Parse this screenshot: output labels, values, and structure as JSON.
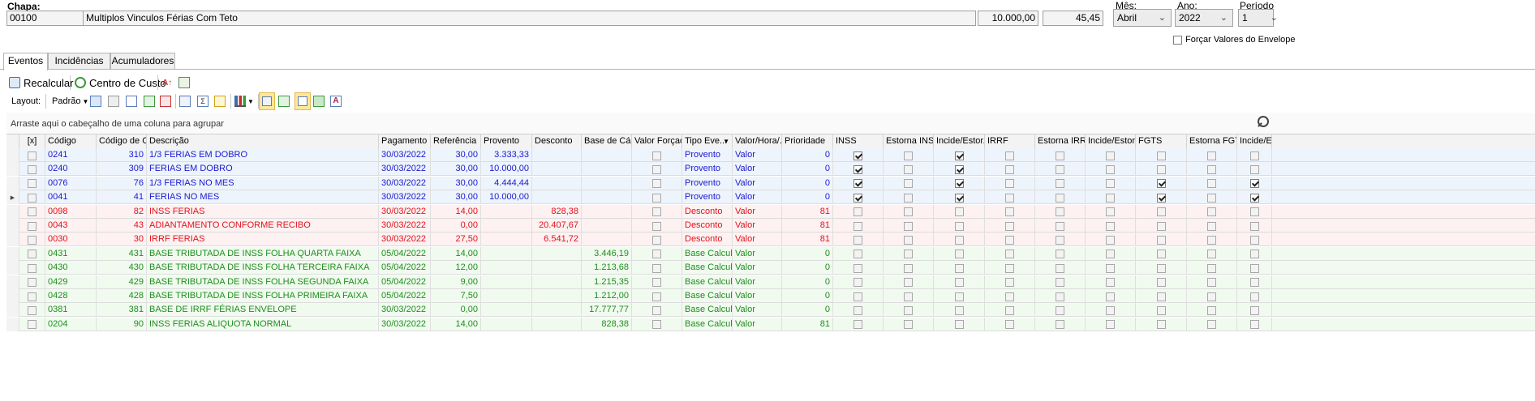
{
  "header": {
    "chapa_label": "Chapa:",
    "chapa_code": "00100",
    "chapa_desc": "Multiplos Vinculos Férias Com Teto",
    "value1": "10.000,00",
    "value2": "45,45",
    "mes_label": "Mês:",
    "mes_value": "Abril",
    "ano_label": "Ano:",
    "ano_value": "2022",
    "periodo_label": "Período",
    "periodo_value": "1",
    "forcar_label": "Forçar Valores do Envelope"
  },
  "tabs": [
    {
      "label": "Eventos",
      "active": true
    },
    {
      "label": "Incidências",
      "active": false
    },
    {
      "label": "Acumuladores",
      "active": false
    }
  ],
  "toolbar": {
    "recalcular": "Recalcular",
    "centro_custo": "Centro de Custo",
    "layout_label": "Layout:",
    "layout_value": "Padrão"
  },
  "group_hint": "Arraste aqui o cabeçalho de uma coluna para agrupar",
  "columns": [
    "[x]",
    "Código",
    "Código de C...",
    "Descrição",
    "Pagamento",
    "Referência",
    "Provento",
    "Desconto",
    "Base de Cál...",
    "Valor Forçado",
    "Tipo Eve...",
    "Valor/Hora/...",
    "Prioridade",
    "INSS",
    "Estorna INSS",
    "Incide/Estor...",
    "IRRF",
    "Estorna IRRF",
    "Incide/Estor...",
    "FGTS",
    "Estorna FGTS",
    "Incide/Est"
  ],
  "colors": {
    "blue": "#1a1ad0",
    "red": "#e0141e",
    "green": "#1e8f1e",
    "blue_bg": "#eef4fc",
    "red_bg": "#fdf1f1",
    "green_bg": "#f1faef"
  },
  "rows": [
    {
      "type": "blue",
      "codigo": "0241",
      "cod_c": "310",
      "descricao": "1/3 FERIAS EM DOBRO",
      "pagamento": "30/03/2022",
      "referencia": "30,00",
      "provento": "3.333,33",
      "desconto": "",
      "base": "",
      "tipo": "Provento",
      "valor_hora": "Valor",
      "prioridade": "0",
      "inss": true,
      "incide1": true,
      "fgts": false,
      "incide3": false,
      "current": false
    },
    {
      "type": "blue",
      "codigo": "0240",
      "cod_c": "309",
      "descricao": "FERIAS EM DOBRO",
      "pagamento": "30/03/2022",
      "referencia": "30,00",
      "provento": "10.000,00",
      "desconto": "",
      "base": "",
      "tipo": "Provento",
      "valor_hora": "Valor",
      "prioridade": "0",
      "inss": true,
      "incide1": true,
      "fgts": false,
      "incide3": false,
      "current": false
    },
    {
      "type": "blue",
      "codigo": "0076",
      "cod_c": "76",
      "descricao": "1/3 FERIAS NO MES",
      "pagamento": "30/03/2022",
      "referencia": "30,00",
      "provento": "4.444,44",
      "desconto": "",
      "base": "",
      "tipo": "Provento",
      "valor_hora": "Valor",
      "prioridade": "0",
      "inss": true,
      "incide1": true,
      "fgts": true,
      "incide3": true,
      "current": false
    },
    {
      "type": "blue",
      "codigo": "0041",
      "cod_c": "41",
      "descricao": "FERIAS NO MES",
      "pagamento": "30/03/2022",
      "referencia": "30,00",
      "provento": "10.000,00",
      "desconto": "",
      "base": "",
      "tipo": "Provento",
      "valor_hora": "Valor",
      "prioridade": "0",
      "inss": true,
      "incide1": true,
      "fgts": true,
      "incide3": true,
      "current": true
    },
    {
      "type": "red",
      "codigo": "0098",
      "cod_c": "82",
      "descricao": "INSS FERIAS",
      "pagamento": "30/03/2022",
      "referencia": "14,00",
      "provento": "",
      "desconto": "828,38",
      "base": "",
      "tipo": "Desconto",
      "valor_hora": "Valor",
      "prioridade": "81",
      "inss": false,
      "incide1": false,
      "fgts": false,
      "incide3": false,
      "current": false
    },
    {
      "type": "red",
      "codigo": "0043",
      "cod_c": "43",
      "descricao": "ADIANTAMENTO CONFORME RECIBO",
      "pagamento": "30/03/2022",
      "referencia": "0,00",
      "provento": "",
      "desconto": "20.407,67",
      "base": "",
      "tipo": "Desconto",
      "valor_hora": "Valor",
      "prioridade": "81",
      "inss": false,
      "incide1": false,
      "fgts": false,
      "incide3": false,
      "current": false
    },
    {
      "type": "red",
      "codigo": "0030",
      "cod_c": "30",
      "descricao": "IRRF FERIAS",
      "pagamento": "30/03/2022",
      "referencia": "27,50",
      "provento": "",
      "desconto": "6.541,72",
      "base": "",
      "tipo": "Desconto",
      "valor_hora": "Valor",
      "prioridade": "81",
      "inss": false,
      "incide1": false,
      "fgts": false,
      "incide3": false,
      "current": false
    },
    {
      "type": "green",
      "codigo": "0431",
      "cod_c": "431",
      "descricao": "BASE TRIBUTADA DE INSS FOLHA QUARTA FAIXA",
      "pagamento": "05/04/2022",
      "referencia": "14,00",
      "provento": "",
      "desconto": "",
      "base": "3.446,19",
      "tipo": "Base Calculo",
      "valor_hora": "Valor",
      "prioridade": "0",
      "inss": false,
      "incide1": false,
      "fgts": false,
      "incide3": false,
      "current": false
    },
    {
      "type": "green",
      "codigo": "0430",
      "cod_c": "430",
      "descricao": "BASE TRIBUTADA DE INSS FOLHA TERCEIRA FAIXA",
      "pagamento": "05/04/2022",
      "referencia": "12,00",
      "provento": "",
      "desconto": "",
      "base": "1.213,68",
      "tipo": "Base Calculo",
      "valor_hora": "Valor",
      "prioridade": "0",
      "inss": false,
      "incide1": false,
      "fgts": false,
      "incide3": false,
      "current": false
    },
    {
      "type": "green",
      "codigo": "0429",
      "cod_c": "429",
      "descricao": "BASE TRIBUTADA DE INSS FOLHA SEGUNDA FAIXA",
      "pagamento": "05/04/2022",
      "referencia": "9,00",
      "provento": "",
      "desconto": "",
      "base": "1.215,35",
      "tipo": "Base Calculo",
      "valor_hora": "Valor",
      "prioridade": "0",
      "inss": false,
      "incide1": false,
      "fgts": false,
      "incide3": false,
      "current": false
    },
    {
      "type": "green",
      "codigo": "0428",
      "cod_c": "428",
      "descricao": "BASE TRIBUTADA DE INSS FOLHA PRIMEIRA FAIXA",
      "pagamento": "05/04/2022",
      "referencia": "7,50",
      "provento": "",
      "desconto": "",
      "base": "1.212,00",
      "tipo": "Base Calculo",
      "valor_hora": "Valor",
      "prioridade": "0",
      "inss": false,
      "incide1": false,
      "fgts": false,
      "incide3": false,
      "current": false
    },
    {
      "type": "green",
      "codigo": "0381",
      "cod_c": "381",
      "descricao": "BASE DE IRRF FÉRIAS ENVELOPE",
      "pagamento": "30/03/2022",
      "referencia": "0,00",
      "provento": "",
      "desconto": "",
      "base": "17.777,77",
      "tipo": "Base Calculo",
      "valor_hora": "Valor",
      "prioridade": "0",
      "inss": false,
      "incide1": false,
      "fgts": false,
      "incide3": false,
      "current": false
    },
    {
      "type": "green",
      "codigo": "0204",
      "cod_c": "90",
      "descricao": "INSS FERIAS ALIQUOTA NORMAL",
      "pagamento": "30/03/2022",
      "referencia": "14,00",
      "provento": "",
      "desconto": "",
      "base": "828,38",
      "tipo": "Base Calculo",
      "valor_hora": "Valor",
      "prioridade": "81",
      "inss": false,
      "incide1": false,
      "fgts": false,
      "incide3": false,
      "current": false
    }
  ]
}
